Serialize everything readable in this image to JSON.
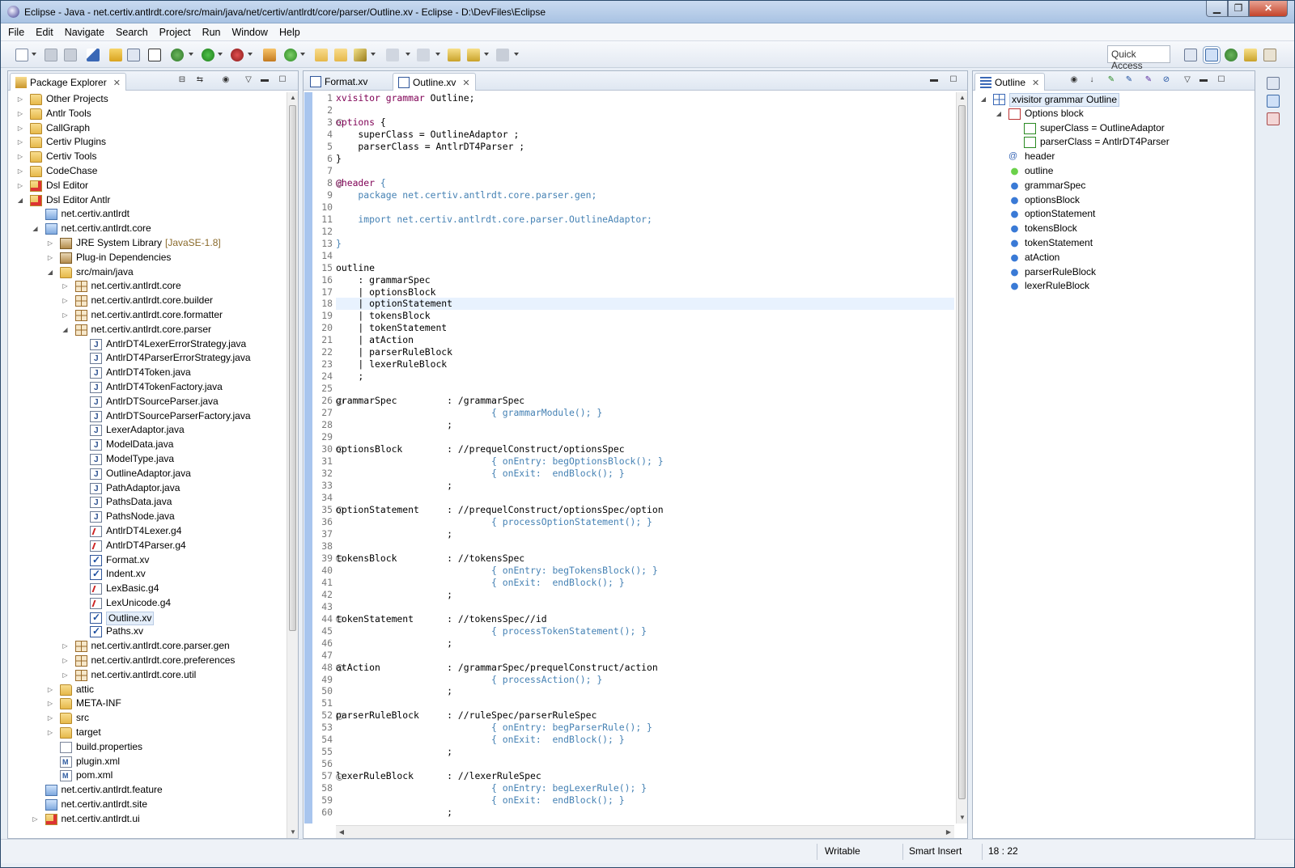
{
  "window": {
    "title": "Eclipse - Java - net.certiv.antlrdt.core/src/main/java/net/certiv/antlrdt/core/parser/Outline.xv - Eclipse - D:\\DevFiles\\Eclipse",
    "min": "▁",
    "max": "❐",
    "close": "✕"
  },
  "menu": [
    "File",
    "Edit",
    "Navigate",
    "Search",
    "Project",
    "Run",
    "Window",
    "Help"
  ],
  "toolbar": {
    "quick_access": "Quick Access"
  },
  "package_explorer": {
    "title": "Package Explorer",
    "tree": [
      {
        "label": "Other Projects",
        "indent": 0,
        "arrow": "right",
        "icon": "folder-icon"
      },
      {
        "label": "Antlr Tools",
        "indent": 0,
        "arrow": "right",
        "icon": "folder-icon"
      },
      {
        "label": "CallGraph",
        "indent": 0,
        "arrow": "right",
        "icon": "folder-icon"
      },
      {
        "label": "Certiv Plugins",
        "indent": 0,
        "arrow": "right",
        "icon": "folder-icon"
      },
      {
        "label": "Certiv Tools",
        "indent": 0,
        "arrow": "right",
        "icon": "folder-icon"
      },
      {
        "label": "CodeChase",
        "indent": 0,
        "arrow": "right",
        "icon": "folder-icon"
      },
      {
        "label": "Dsl Editor",
        "indent": 0,
        "arrow": "right",
        "icon": "project-error-icon"
      },
      {
        "label": "Dsl Editor Antlr",
        "indent": 0,
        "arrow": "down",
        "icon": "project-error-icon"
      },
      {
        "label": "net.certiv.antlrdt",
        "indent": 1,
        "arrow": "",
        "icon": "project-icon"
      },
      {
        "label": "net.certiv.antlrdt.core",
        "indent": 1,
        "arrow": "down",
        "icon": "project-icon"
      },
      {
        "label": "JRE System Library",
        "decoration": "[JavaSE-1.8]",
        "indent": 2,
        "arrow": "right",
        "icon": "library-icon"
      },
      {
        "label": "Plug-in Dependencies",
        "indent": 2,
        "arrow": "right",
        "icon": "library-icon"
      },
      {
        "label": "src/main/java",
        "indent": 2,
        "arrow": "down",
        "icon": "source-folder-icon"
      },
      {
        "label": "net.certiv.antlrdt.core",
        "indent": 3,
        "arrow": "right",
        "icon": "package-icon"
      },
      {
        "label": "net.certiv.antlrdt.core.builder",
        "indent": 3,
        "arrow": "right",
        "icon": "package-icon"
      },
      {
        "label": "net.certiv.antlrdt.core.formatter",
        "indent": 3,
        "arrow": "right",
        "icon": "package-icon"
      },
      {
        "label": "net.certiv.antlrdt.core.parser",
        "indent": 3,
        "arrow": "down",
        "icon": "package-icon"
      },
      {
        "label": "AntlrDT4LexerErrorStrategy.java",
        "indent": 4,
        "arrow": "",
        "icon": "java-file-icon"
      },
      {
        "label": "AntlrDT4ParserErrorStrategy.java",
        "indent": 4,
        "arrow": "",
        "icon": "java-file-icon"
      },
      {
        "label": "AntlrDT4Token.java",
        "indent": 4,
        "arrow": "",
        "icon": "java-file-icon"
      },
      {
        "label": "AntlrDT4TokenFactory.java",
        "indent": 4,
        "arrow": "",
        "icon": "java-file-icon"
      },
      {
        "label": "AntlrDTSourceParser.java",
        "indent": 4,
        "arrow": "",
        "icon": "java-file-icon"
      },
      {
        "label": "AntlrDTSourceParserFactory.java",
        "indent": 4,
        "arrow": "",
        "icon": "java-file-icon"
      },
      {
        "label": "LexerAdaptor.java",
        "indent": 4,
        "arrow": "",
        "icon": "java-file-icon"
      },
      {
        "label": "ModelData.java",
        "indent": 4,
        "arrow": "",
        "icon": "java-file-icon"
      },
      {
        "label": "ModelType.java",
        "indent": 4,
        "arrow": "",
        "icon": "java-file-icon"
      },
      {
        "label": "OutlineAdaptor.java",
        "indent": 4,
        "arrow": "",
        "icon": "java-file-icon"
      },
      {
        "label": "PathAdaptor.java",
        "indent": 4,
        "arrow": "",
        "icon": "java-file-icon"
      },
      {
        "label": "PathsData.java",
        "indent": 4,
        "arrow": "",
        "icon": "java-file-icon"
      },
      {
        "label": "PathsNode.java",
        "indent": 4,
        "arrow": "",
        "icon": "java-file-icon"
      },
      {
        "label": "AntlrDT4Lexer.g4",
        "indent": 4,
        "arrow": "",
        "icon": "grammar-file-icon"
      },
      {
        "label": "AntlrDT4Parser.g4",
        "indent": 4,
        "arrow": "",
        "icon": "grammar-file-icon"
      },
      {
        "label": "Format.xv",
        "indent": 4,
        "arrow": "",
        "icon": "xvisitor-file-icon"
      },
      {
        "label": "Indent.xv",
        "indent": 4,
        "arrow": "",
        "icon": "xvisitor-file-icon"
      },
      {
        "label": "LexBasic.g4",
        "indent": 4,
        "arrow": "",
        "icon": "grammar-file-icon"
      },
      {
        "label": "LexUnicode.g4",
        "indent": 4,
        "arrow": "",
        "icon": "grammar-file-icon"
      },
      {
        "label": "Outline.xv",
        "indent": 4,
        "arrow": "",
        "icon": "xvisitor-file-icon",
        "selected": true
      },
      {
        "label": "Paths.xv",
        "indent": 4,
        "arrow": "",
        "icon": "xvisitor-file-icon"
      },
      {
        "label": "net.certiv.antlrdt.core.parser.gen",
        "indent": 3,
        "arrow": "right",
        "icon": "package-icon"
      },
      {
        "label": "net.certiv.antlrdt.core.preferences",
        "indent": 3,
        "arrow": "right",
        "icon": "package-icon"
      },
      {
        "label": "net.certiv.antlrdt.core.util",
        "indent": 3,
        "arrow": "right",
        "icon": "package-icon"
      },
      {
        "label": "attic",
        "indent": 2,
        "arrow": "right",
        "icon": "folder-icon"
      },
      {
        "label": "META-INF",
        "indent": 2,
        "arrow": "right",
        "icon": "folder-icon"
      },
      {
        "label": "src",
        "indent": 2,
        "arrow": "right",
        "icon": "folder-icon"
      },
      {
        "label": "target",
        "indent": 2,
        "arrow": "right",
        "icon": "folder-icon"
      },
      {
        "label": "build.properties",
        "indent": 2,
        "arrow": "",
        "icon": "properties-file-icon"
      },
      {
        "label": "plugin.xml",
        "indent": 2,
        "arrow": "",
        "icon": "xml-file-icon"
      },
      {
        "label": "pom.xml",
        "indent": 2,
        "arrow": "",
        "icon": "xml-file-icon"
      },
      {
        "label": "net.certiv.antlrdt.feature",
        "indent": 1,
        "arrow": "",
        "icon": "project-icon"
      },
      {
        "label": "net.certiv.antlrdt.site",
        "indent": 1,
        "arrow": "",
        "icon": "project-icon"
      },
      {
        "label": "net.certiv.antlrdt.ui",
        "indent": 1,
        "arrow": "right",
        "icon": "project-error-icon"
      }
    ]
  },
  "editor": {
    "tabs": [
      {
        "label": "Format.xv",
        "active": false
      },
      {
        "label": "Outline.xv",
        "active": true
      }
    ],
    "current_line": 18,
    "lines": [
      {
        "n": "1",
        "segs": [
          {
            "t": "xvisitor grammar",
            "c": "kw"
          },
          {
            "t": " Outline;",
            "c": ""
          }
        ]
      },
      {
        "n": "2",
        "segs": []
      },
      {
        "n": "3",
        "fold": true,
        "segs": [
          {
            "t": "options",
            "c": "kw"
          },
          {
            "t": " {",
            "c": ""
          }
        ]
      },
      {
        "n": "4",
        "segs": [
          {
            "t": "    superClass = OutlineAdaptor ;",
            "c": ""
          }
        ]
      },
      {
        "n": "5",
        "segs": [
          {
            "t": "    parserClass = AntlrDT4Parser ;",
            "c": ""
          }
        ]
      },
      {
        "n": "6",
        "segs": [
          {
            "t": "}",
            "c": ""
          }
        ]
      },
      {
        "n": "7",
        "segs": []
      },
      {
        "n": "8",
        "fold": true,
        "segs": [
          {
            "t": "@header",
            "c": "kw"
          },
          {
            "t": " {",
            "c": "act"
          }
        ]
      },
      {
        "n": "9",
        "segs": [
          {
            "t": "    package net.certiv.antlrdt.core.parser.gen;",
            "c": "act"
          }
        ]
      },
      {
        "n": "10",
        "segs": []
      },
      {
        "n": "11",
        "segs": [
          {
            "t": "    import net.certiv.antlrdt.core.parser.OutlineAdaptor;",
            "c": "act"
          }
        ]
      },
      {
        "n": "12",
        "segs": []
      },
      {
        "n": "13",
        "segs": [
          {
            "t": "}",
            "c": "act"
          }
        ]
      },
      {
        "n": "14",
        "segs": []
      },
      {
        "n": "15",
        "segs": [
          {
            "t": "outline",
            "c": ""
          }
        ]
      },
      {
        "n": "16",
        "segs": [
          {
            "t": "    : grammarSpec",
            "c": ""
          }
        ]
      },
      {
        "n": "17",
        "segs": [
          {
            "t": "    | optionsBlock",
            "c": ""
          }
        ]
      },
      {
        "n": "18",
        "segs": [
          {
            "t": "    | optionStatement",
            "c": ""
          }
        ]
      },
      {
        "n": "19",
        "segs": [
          {
            "t": "    | tokensBlock",
            "c": ""
          }
        ]
      },
      {
        "n": "20",
        "segs": [
          {
            "t": "    | tokenStatement",
            "c": ""
          }
        ]
      },
      {
        "n": "21",
        "segs": [
          {
            "t": "    | atAction",
            "c": ""
          }
        ]
      },
      {
        "n": "22",
        "segs": [
          {
            "t": "    | parserRuleBlock",
            "c": ""
          }
        ]
      },
      {
        "n": "23",
        "segs": [
          {
            "t": "    | lexerRuleBlock",
            "c": ""
          }
        ]
      },
      {
        "n": "24",
        "segs": [
          {
            "t": "    ;",
            "c": ""
          }
        ]
      },
      {
        "n": "25",
        "segs": []
      },
      {
        "n": "26",
        "fold": true,
        "segs": [
          {
            "t": "grammarSpec         : /grammarSpec",
            "c": ""
          }
        ]
      },
      {
        "n": "27",
        "segs": [
          {
            "t": "                            { grammarModule(); }",
            "c": "act"
          }
        ]
      },
      {
        "n": "28",
        "segs": [
          {
            "t": "                    ;",
            "c": ""
          }
        ]
      },
      {
        "n": "29",
        "segs": []
      },
      {
        "n": "30",
        "fold": true,
        "segs": [
          {
            "t": "optionsBlock        : //prequelConstruct/optionsSpec",
            "c": ""
          }
        ]
      },
      {
        "n": "31",
        "segs": [
          {
            "t": "                            { onEntry: begOptionsBlock(); }",
            "c": "act"
          }
        ]
      },
      {
        "n": "32",
        "segs": [
          {
            "t": "                            { onExit:  endBlock(); }",
            "c": "act"
          }
        ]
      },
      {
        "n": "33",
        "segs": [
          {
            "t": "                    ;",
            "c": ""
          }
        ]
      },
      {
        "n": "34",
        "segs": []
      },
      {
        "n": "35",
        "fold": true,
        "segs": [
          {
            "t": "optionStatement     : //prequelConstruct/optionsSpec/option",
            "c": ""
          }
        ]
      },
      {
        "n": "36",
        "segs": [
          {
            "t": "                            { processOptionStatement(); }",
            "c": "act"
          }
        ]
      },
      {
        "n": "37",
        "segs": [
          {
            "t": "                    ;",
            "c": ""
          }
        ]
      },
      {
        "n": "38",
        "segs": []
      },
      {
        "n": "39",
        "fold": true,
        "segs": [
          {
            "t": "tokensBlock         : //tokensSpec",
            "c": ""
          }
        ]
      },
      {
        "n": "40",
        "segs": [
          {
            "t": "                            { onEntry: begTokensBlock(); }",
            "c": "act"
          }
        ]
      },
      {
        "n": "41",
        "segs": [
          {
            "t": "                            { onExit:  endBlock(); }",
            "c": "act"
          }
        ]
      },
      {
        "n": "42",
        "segs": [
          {
            "t": "                    ;",
            "c": ""
          }
        ]
      },
      {
        "n": "43",
        "segs": []
      },
      {
        "n": "44",
        "fold": true,
        "segs": [
          {
            "t": "tokenStatement      : //tokensSpec//id",
            "c": ""
          }
        ]
      },
      {
        "n": "45",
        "segs": [
          {
            "t": "                            { processTokenStatement(); }",
            "c": "act"
          }
        ]
      },
      {
        "n": "46",
        "segs": [
          {
            "t": "                    ;",
            "c": ""
          }
        ]
      },
      {
        "n": "47",
        "segs": []
      },
      {
        "n": "48",
        "fold": true,
        "segs": [
          {
            "t": "atAction            : /grammarSpec/prequelConstruct/action",
            "c": ""
          }
        ]
      },
      {
        "n": "49",
        "segs": [
          {
            "t": "                            { processAction(); }",
            "c": "act"
          }
        ]
      },
      {
        "n": "50",
        "segs": [
          {
            "t": "                    ;",
            "c": ""
          }
        ]
      },
      {
        "n": "51",
        "segs": []
      },
      {
        "n": "52",
        "fold": true,
        "segs": [
          {
            "t": "parserRuleBlock     : //ruleSpec/parserRuleSpec",
            "c": ""
          }
        ]
      },
      {
        "n": "53",
        "segs": [
          {
            "t": "                            { onEntry: begParserRule(); }",
            "c": "act"
          }
        ]
      },
      {
        "n": "54",
        "segs": [
          {
            "t": "                            { onExit:  endBlock(); }",
            "c": "act"
          }
        ]
      },
      {
        "n": "55",
        "segs": [
          {
            "t": "                    ;",
            "c": ""
          }
        ]
      },
      {
        "n": "56",
        "segs": []
      },
      {
        "n": "57",
        "fold": true,
        "segs": [
          {
            "t": "lexerRuleBlock      : //lexerRuleSpec",
            "c": ""
          }
        ]
      },
      {
        "n": "58",
        "segs": [
          {
            "t": "                            { onEntry: begLexerRule(); }",
            "c": "act"
          }
        ]
      },
      {
        "n": "59",
        "segs": [
          {
            "t": "                            { onExit:  endBlock(); }",
            "c": "act"
          }
        ]
      },
      {
        "n": "60",
        "segs": [
          {
            "t": "                    ;",
            "c": ""
          }
        ]
      }
    ]
  },
  "outline": {
    "title": "Outline",
    "items": [
      {
        "label": "xvisitor grammar Outline",
        "indent": 0,
        "arrow": "down",
        "icon": "grammar-icon",
        "selected": true
      },
      {
        "label": "Options block",
        "indent": 1,
        "arrow": "down",
        "icon": "options-icon"
      },
      {
        "label": "superClass = OutlineAdaptor",
        "indent": 2,
        "arrow": "",
        "icon": "option-value-icon"
      },
      {
        "label": "parserClass = AntlrDT4Parser",
        "indent": 2,
        "arrow": "",
        "icon": "option-value-icon"
      },
      {
        "label": "header",
        "indent": 1,
        "arrow": "",
        "icon": "at-icon"
      },
      {
        "label": "outline",
        "indent": 1,
        "arrow": "",
        "icon": "green-dot-icon"
      },
      {
        "label": "grammarSpec",
        "indent": 1,
        "arrow": "",
        "icon": "blue-dot-icon"
      },
      {
        "label": "optionsBlock",
        "indent": 1,
        "arrow": "",
        "icon": "blue-dot-icon"
      },
      {
        "label": "optionStatement",
        "indent": 1,
        "arrow": "",
        "icon": "blue-dot-icon"
      },
      {
        "label": "tokensBlock",
        "indent": 1,
        "arrow": "",
        "icon": "blue-dot-icon"
      },
      {
        "label": "tokenStatement",
        "indent": 1,
        "arrow": "",
        "icon": "blue-dot-icon"
      },
      {
        "label": "atAction",
        "indent": 1,
        "arrow": "",
        "icon": "blue-dot-icon"
      },
      {
        "label": "parserRuleBlock",
        "indent": 1,
        "arrow": "",
        "icon": "blue-dot-icon"
      },
      {
        "label": "lexerRuleBlock",
        "indent": 1,
        "arrow": "",
        "icon": "blue-dot-icon"
      }
    ]
  },
  "status": {
    "writable": "Writable",
    "insert_mode": "Smart Insert",
    "position": "18 : 22"
  }
}
